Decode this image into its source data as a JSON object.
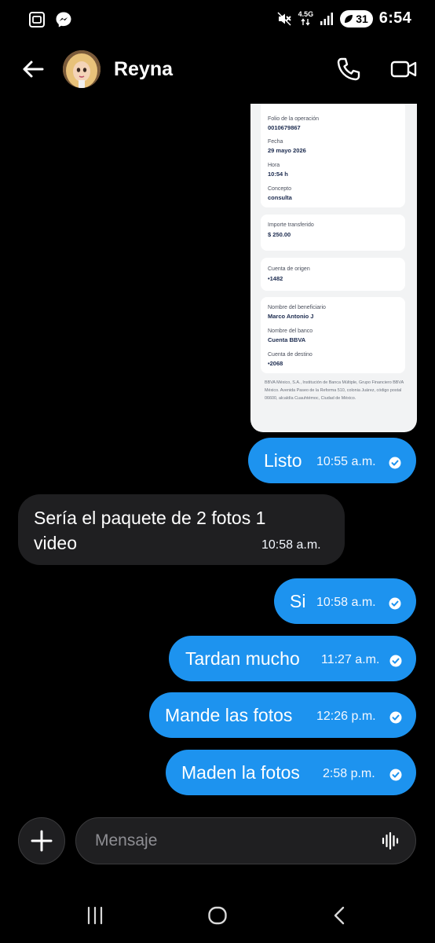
{
  "status_bar": {
    "time": "6:54",
    "network": "4.5G",
    "notification_count": "31"
  },
  "header": {
    "contact_name": "Reyna"
  },
  "receipt": {
    "folio_label": "Folio de la operación",
    "folio_value": "0010679867",
    "fecha_label": "Fecha",
    "fecha_value": "29 mayo 2026",
    "hora_label": "Hora",
    "hora_value": "10:54 h",
    "concepto_label": "Concepto",
    "concepto_value": "consulta",
    "importe_label": "Importe transferido",
    "importe_value": "$ 250.00",
    "origen_label": "Cuenta de origen",
    "origen_value": "•1482",
    "beneficiario_label": "Nombre del beneficiario",
    "beneficiario_value": "Marco Antonio J",
    "banco_label": "Nombre del banco",
    "banco_value": "Cuenta BBVA",
    "destino_label": "Cuenta de destino",
    "destino_value": "•2068",
    "footer": "BBVA México, S.A., Institución de Banca Múltiple, Grupo Financiero BBVA México. Avenida Paseo de la Reforma 510, colonia Juárez, código postal 06600, alcaldía Cuauhtémoc, Ciudad de México."
  },
  "messages": [
    {
      "direction": "out",
      "text": "Listo",
      "time": "10:55 a.m."
    },
    {
      "direction": "in",
      "text_line1": "Sería el paquete de 2 fotos 1",
      "text_line2": "video",
      "time": "10:58 a.m."
    },
    {
      "direction": "out",
      "text": "Si",
      "time": "10:58 a.m."
    },
    {
      "direction": "out",
      "text": "Tardan mucho",
      "time": "11:27 a.m."
    },
    {
      "direction": "out",
      "text": "Mande las fotos",
      "time": "12:26 p.m."
    },
    {
      "direction": "out",
      "text": "Maden la fotos",
      "time": "2:58 p.m."
    }
  ],
  "composer": {
    "placeholder": "Mensaje"
  },
  "colors": {
    "outgoing_bubble": "#1d93ef",
    "incoming_bubble": "#1f1f21",
    "background": "#000000"
  },
  "icons": {
    "back": "arrow-left-icon",
    "call": "phone-icon",
    "video": "video-camera-icon",
    "plus": "plus-icon",
    "voice": "voice-wave-icon",
    "read": "check-circle-icon"
  }
}
